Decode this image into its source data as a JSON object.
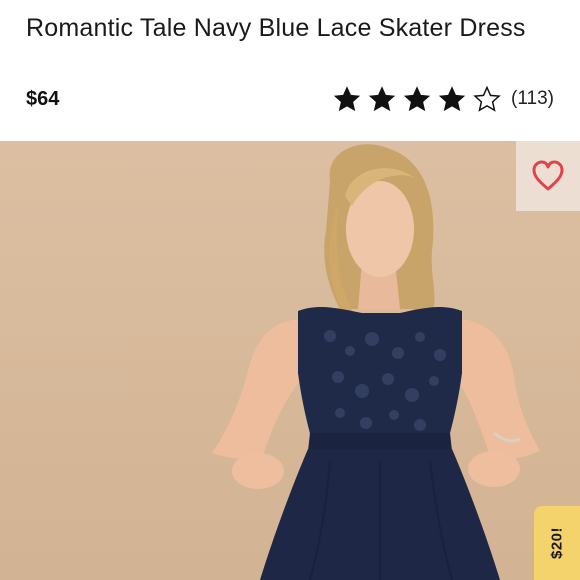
{
  "product": {
    "title": "Romantic Tale Navy Blue Lace Skater Dress",
    "price": "$64",
    "rating": {
      "value": 4,
      "max": 5,
      "count_label": "(113)"
    }
  },
  "photo": {
    "background_color": "#d8bb9c",
    "dress_color": "#1e2846"
  },
  "like_button": {
    "icon": "heart-icon",
    "color": "#e0444a"
  },
  "promo": {
    "label": "$20!"
  },
  "colors": {
    "star_filled": "#111111",
    "star_empty_stroke": "#111111",
    "promo_background": "#f5d36c"
  }
}
